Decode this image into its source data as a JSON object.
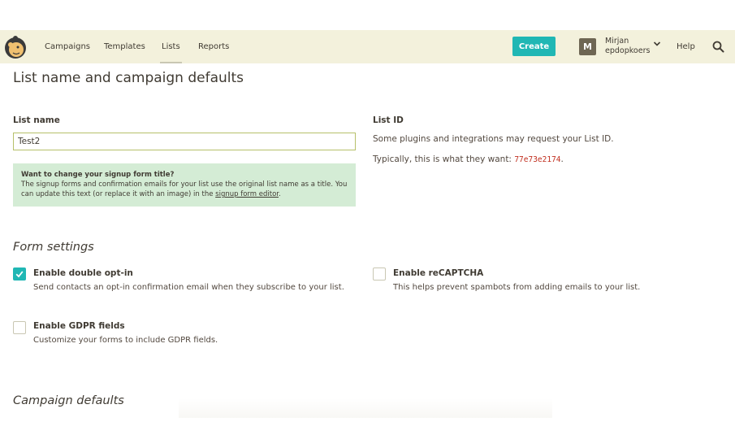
{
  "nav": {
    "items": [
      {
        "label": "Campaigns"
      },
      {
        "label": "Templates"
      },
      {
        "label": "Lists"
      },
      {
        "label": "Reports"
      }
    ],
    "create_label": "Create",
    "avatar_initial": "M",
    "user_name": "Mirjan",
    "user_org": "epdopkoers",
    "help_label": "Help",
    "icons": {
      "logo": "mailchimp-logo-icon",
      "chevron": "chevron-down-icon",
      "search": "search-icon"
    },
    "accent_color": "#20b7b4"
  },
  "page": {
    "title": "List name and campaign defaults"
  },
  "list_name": {
    "label": "List name",
    "value": "Test2",
    "info_title": "Want to change your signup form title?",
    "info_body": "The signup forms and confirmation emails for your list use the original list name as a title. You can update this text (or replace it with an image) in the",
    "info_link": "signup form editor",
    "info_end": "."
  },
  "list_id": {
    "label": "List ID",
    "desc": "Some plugins and integrations may request your List ID.",
    "prefix": "Typically, this is what they want:",
    "value": "77e73e2174",
    "suffix": "."
  },
  "form_settings": {
    "title": "Form settings",
    "options": [
      {
        "label": "Enable double opt-in",
        "desc": "Send contacts an opt-in confirmation email when they subscribe to your list.",
        "checked": true
      },
      {
        "label": "Enable reCAPTCHA",
        "desc": "This helps prevent spambots from adding emails to your list.",
        "checked": false
      },
      {
        "label": "Enable GDPR fields",
        "desc": "Customize your forms to include GDPR fields.",
        "checked": false
      }
    ]
  },
  "campaign_defaults": {
    "title": "Campaign defaults"
  }
}
